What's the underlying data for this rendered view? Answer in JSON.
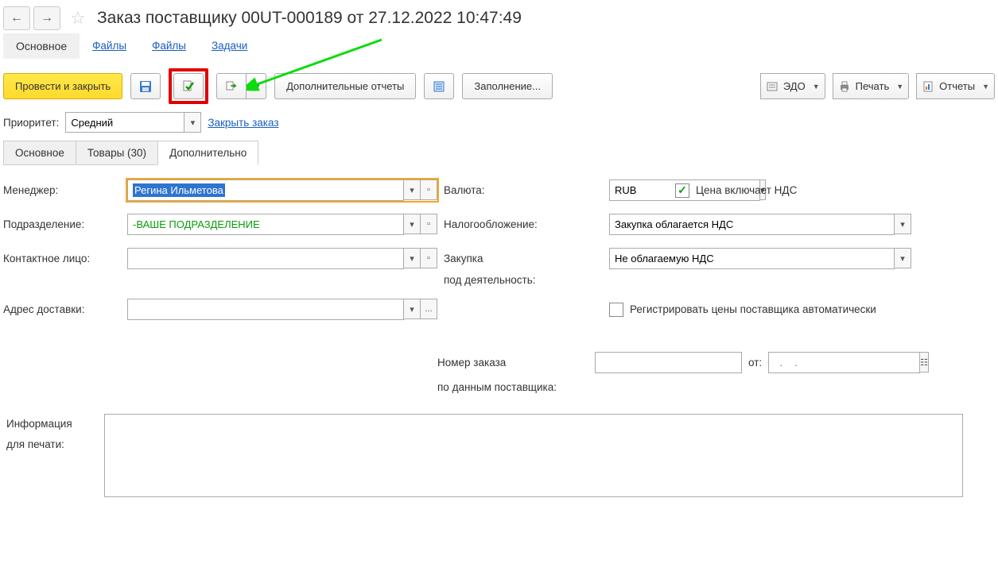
{
  "header": {
    "title": "Заказ поставщику 00UT-000189 от 27.12.2022 10:47:49"
  },
  "topnav": {
    "main": "Основное",
    "files1": "Файлы",
    "files2": "Файлы",
    "tasks": "Задачи"
  },
  "toolbar": {
    "post_close": "Провести и закрыть",
    "extra_reports": "Дополнительные отчеты",
    "fill": "Заполнение...",
    "edo": "ЭДО",
    "print": "Печать",
    "reports": "Отчеты"
  },
  "priority": {
    "label": "Приоритет:",
    "value": "Средний",
    "close_link": "Закрыть заказ"
  },
  "tabs": {
    "main": "Основное",
    "goods": "Товары (30)",
    "additional": "Дополнительно"
  },
  "form": {
    "manager_label": "Менеджер:",
    "manager_value": "Регина Ильметова",
    "currency_label": "Валюта:",
    "currency_value": "RUB",
    "price_includes_vat": "Цена включает НДС",
    "department_label": "Подразделение:",
    "department_value": "-ВАШЕ ПОДРАЗДЕЛЕНИЕ",
    "taxation_label": "Налогообложение:",
    "taxation_value": "Закупка облагается НДС",
    "contact_label": "Контактное лицо:",
    "contact_value": "",
    "purchase_label1": "Закупка",
    "purchase_label2": "под деятельность:",
    "purchase_value": "Не облагаемую НДС",
    "address_label": "Адрес доставки:",
    "address_value": "",
    "auto_prices": "Регистрировать цены поставщика автоматически",
    "order_num_label": "Номер заказа",
    "order_num_value": "",
    "from_label": "от:",
    "date_placeholder": "  .    .    ",
    "supplier_data_label": "по данным поставщика:",
    "info_label1": "Информация",
    "info_label2": "для печати:",
    "info_value": ""
  }
}
